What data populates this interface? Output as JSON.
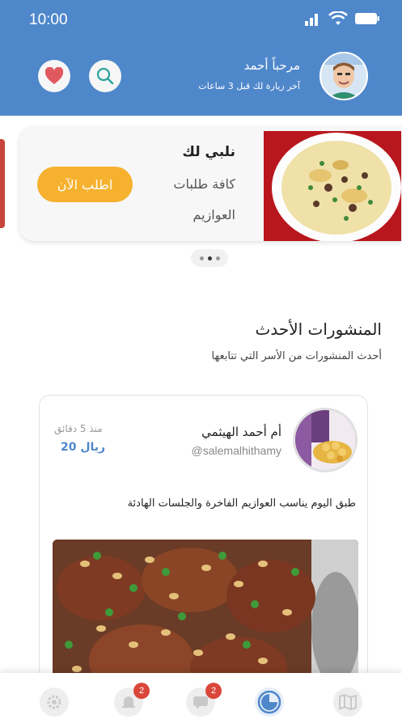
{
  "status_bar": {
    "time": "10:00"
  },
  "header": {
    "greeting": "مرحباً أحمد",
    "last_visit": "آخر زيارة لك قبل 3 ساعات",
    "accent_color": "#4f87cb"
  },
  "promo": {
    "title": "نلبي لك",
    "line1": "كافة طلبات",
    "line2": "العوازيم",
    "button": "اطلب الآن",
    "button_color": "#f6b12e",
    "pages": 3,
    "current_page": 2
  },
  "latest": {
    "title": "المنشورات الأحدث",
    "subtitle": "أحدث المنشورات من الأسر التي تتابعها"
  },
  "post": {
    "author": "أم أحمد الهيثمي",
    "handle": "@salemalhithamy",
    "time": "منذ 5 دقائق",
    "price": "ريال 20",
    "text": "طبق اليوم يناسب العوازيم الفاخرة والجلسات الهادئة"
  },
  "nav": {
    "active": "home",
    "notifications_badge": "2",
    "messages_badge": "2"
  }
}
